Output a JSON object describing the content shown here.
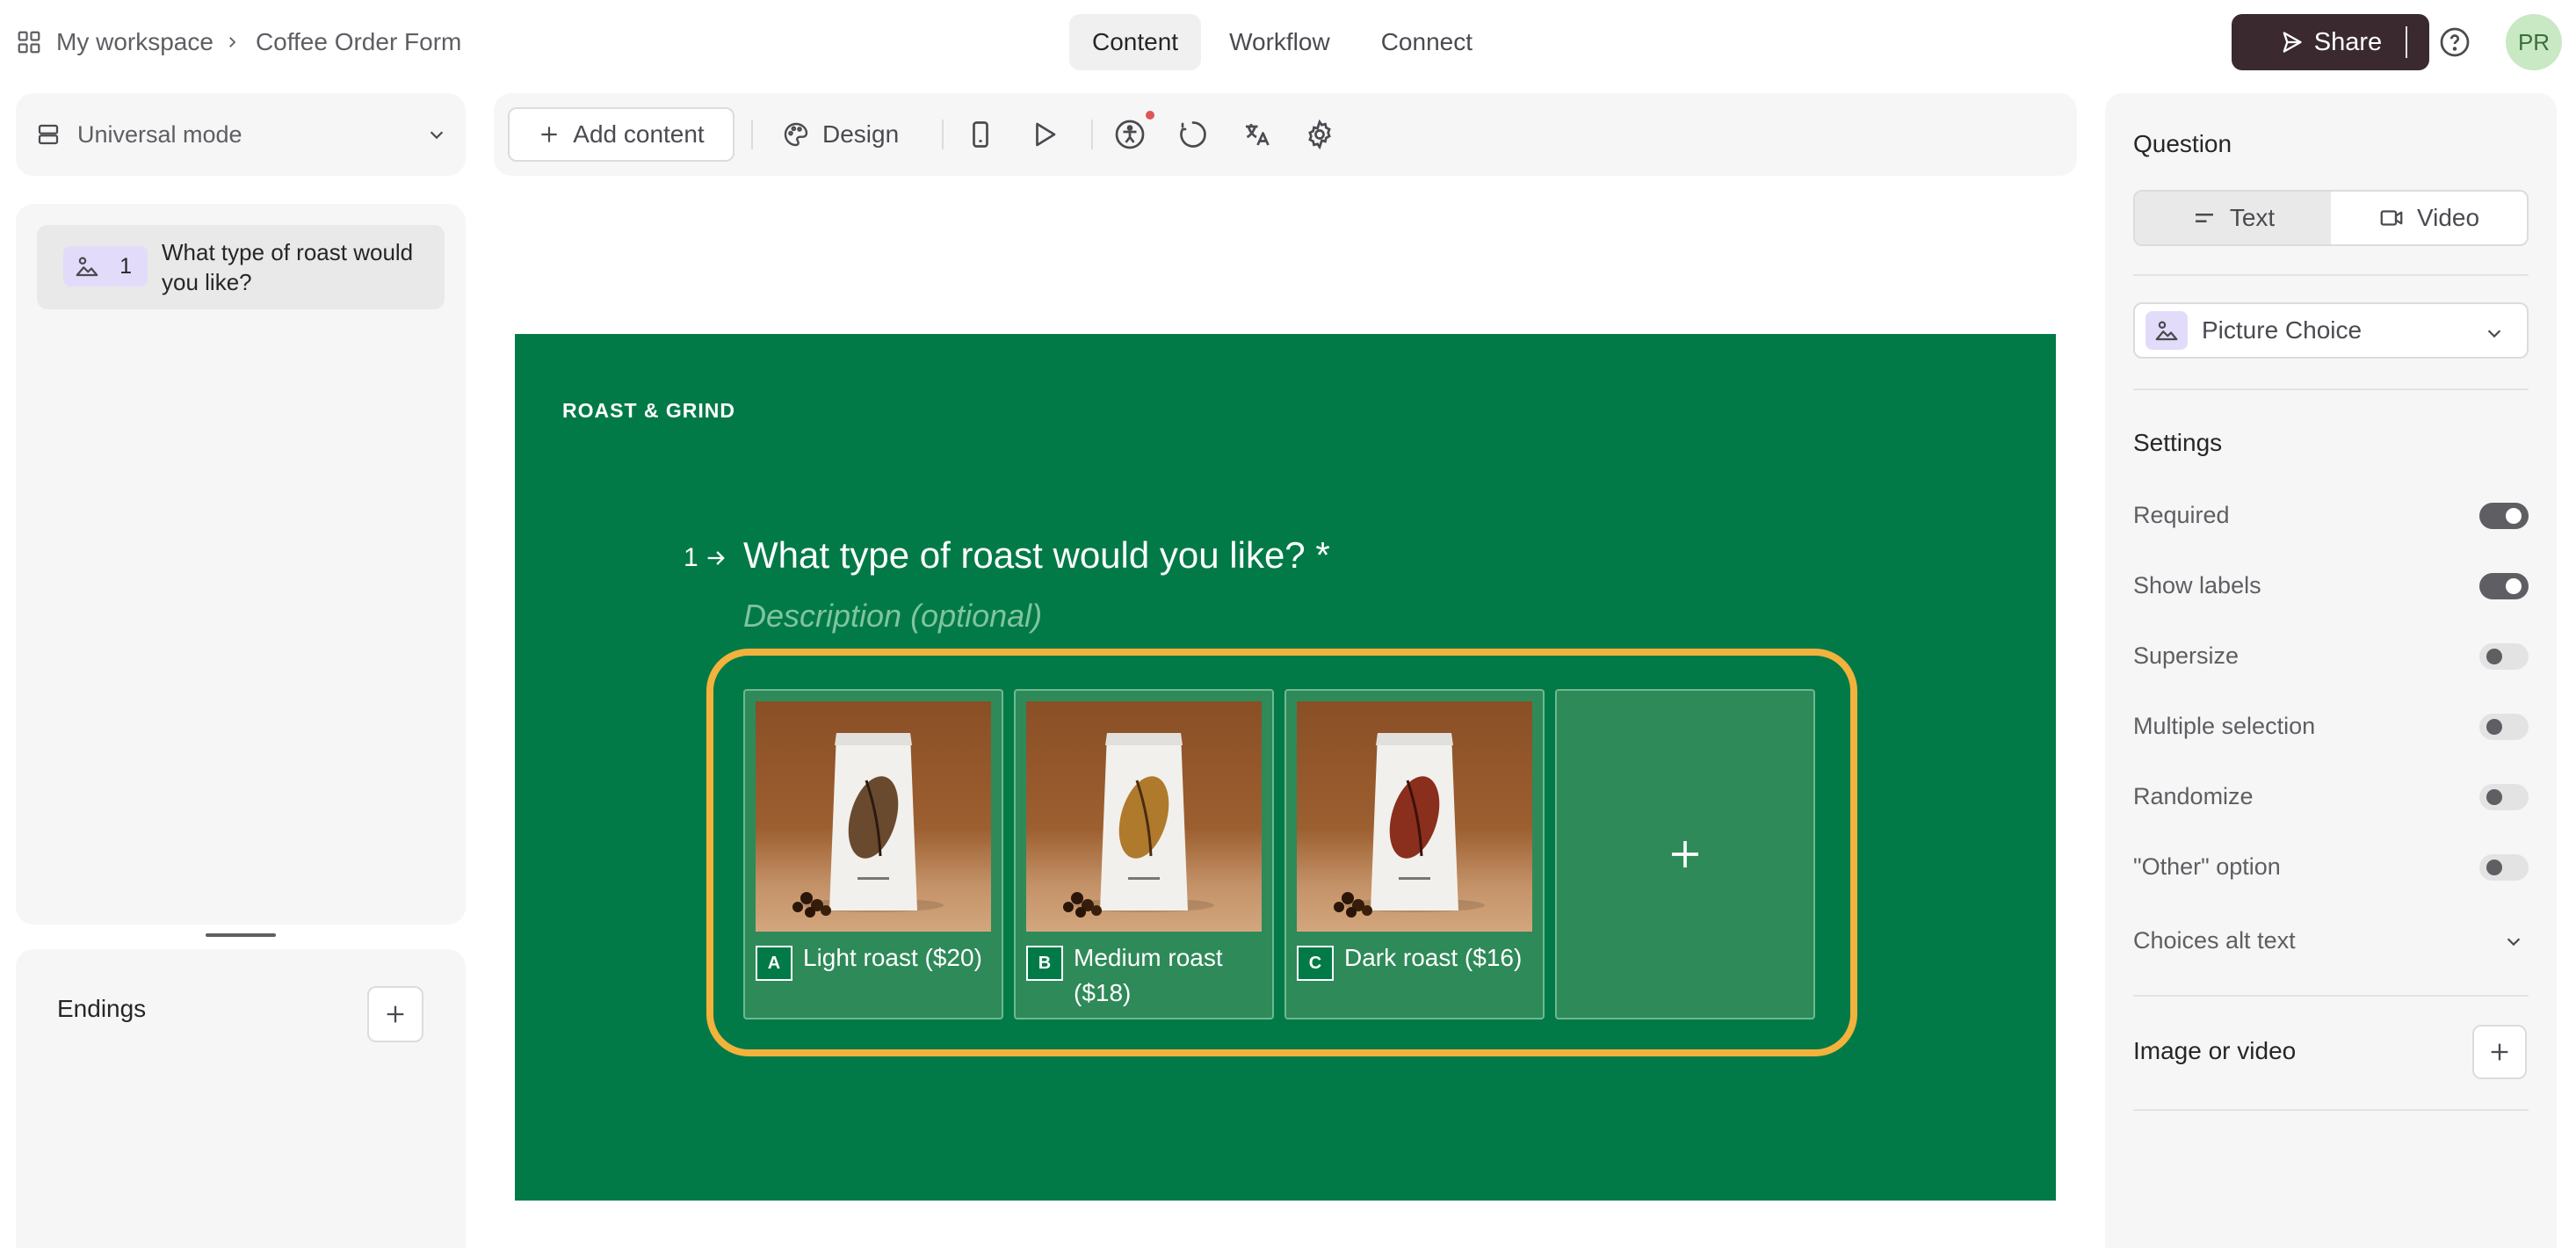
{
  "header": {
    "workspace": "My workspace",
    "form_title": "Coffee Order Form",
    "tabs": [
      {
        "label": "Content",
        "active": true
      },
      {
        "label": "Workflow",
        "active": false
      },
      {
        "label": "Connect",
        "active": false
      }
    ],
    "share_label": "Share",
    "avatar_initials": "PR"
  },
  "left": {
    "mode_label": "Universal mode",
    "questions": [
      {
        "number": "1",
        "title": "What type of roast would you like?",
        "icon": "picture-choice-icon"
      }
    ],
    "endings_label": "Endings"
  },
  "toolbar": {
    "add_content_label": "Add content",
    "design_label": "Design",
    "icons": [
      "mobile-preview-icon",
      "play-icon",
      "accessibility-icon",
      "loading-icon",
      "translate-icon",
      "gear-icon"
    ]
  },
  "canvas": {
    "brand": "ROAST & GRIND",
    "question_number": "1",
    "question_title": "What type of roast would you like? *",
    "description_placeholder": "Description (optional)",
    "choices": [
      {
        "key": "A",
        "label": "Light roast ($20)",
        "bean_color": "#6a4a2e"
      },
      {
        "key": "B",
        "label": "Medium roast ($18)",
        "bean_color": "#b07a2c"
      },
      {
        "key": "C",
        "label": "Dark roast ($16)",
        "bean_color": "#8a2e1e"
      }
    ],
    "colors": {
      "background": "#027a47",
      "selection_frame": "#f2b23c"
    }
  },
  "panel": {
    "question_heading": "Question",
    "type_options": [
      {
        "label": "Text",
        "active": true
      },
      {
        "label": "Video",
        "active": false
      }
    ],
    "question_type": "Picture Choice",
    "settings_heading": "Settings",
    "settings": [
      {
        "label": "Required",
        "on": true
      },
      {
        "label": "Show labels",
        "on": true
      },
      {
        "label": "Supersize",
        "on": false
      },
      {
        "label": "Multiple selection",
        "on": false
      },
      {
        "label": "Randomize",
        "on": false
      },
      {
        "label": "\"Other\" option",
        "on": false
      }
    ],
    "alt_text_label": "Choices alt text",
    "media_label": "Image or video"
  }
}
